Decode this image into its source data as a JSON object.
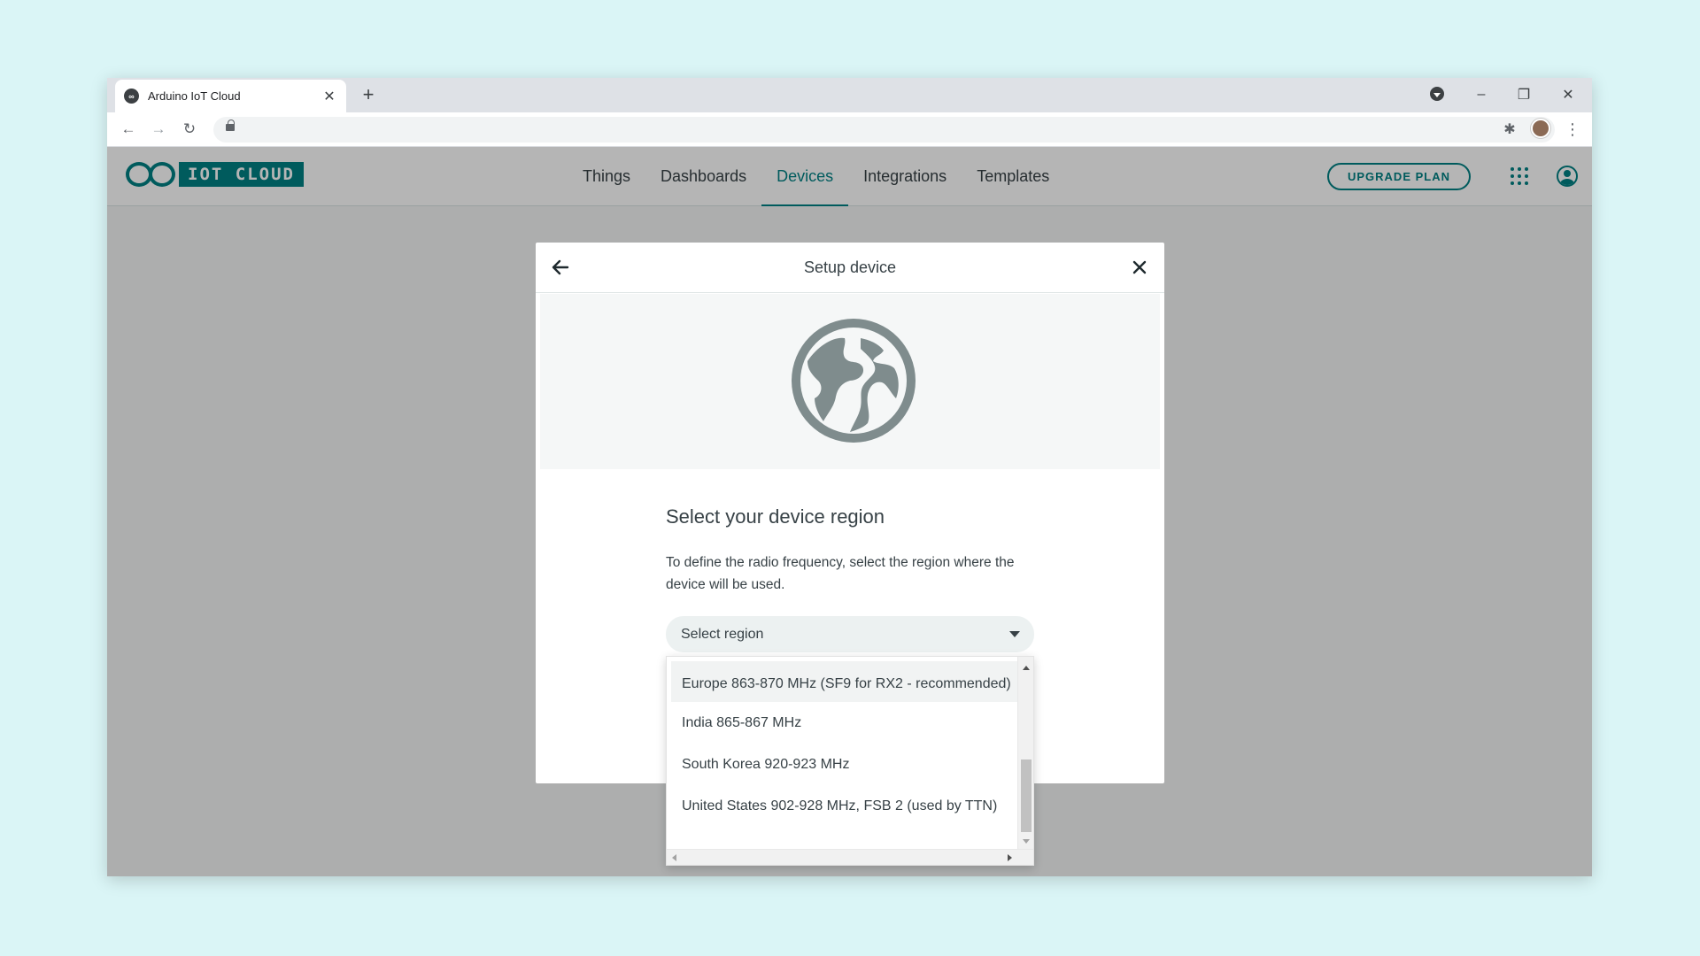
{
  "browser": {
    "tab_title": "Arduino IoT Cloud",
    "new_tab_symbol": "+",
    "controls": {
      "minimize": "–",
      "restore": "❐",
      "close": "✕"
    }
  },
  "app": {
    "logo_text": "IOT CLOUD",
    "nav": [
      "Things",
      "Dashboards",
      "Devices",
      "Integrations",
      "Templates"
    ],
    "active_nav": "Devices",
    "upgrade_label": "UPGRADE PLAN",
    "accent_color": "#008184"
  },
  "modal": {
    "title": "Setup device",
    "heading": "Select your device region",
    "description": "To define the radio frequency, select the region where the device will be used.",
    "select_placeholder": "Select region",
    "hero_icon": "globe-icon"
  },
  "dropdown": {
    "options": [
      "Europe 863-870 MHz (SF9 for RX2 - recommended)",
      "India 865-867 MHz",
      "South Korea 920-923 MHz",
      "United States 902-928 MHz, FSB 2 (used by TTN)"
    ],
    "highlighted_index": 0
  }
}
